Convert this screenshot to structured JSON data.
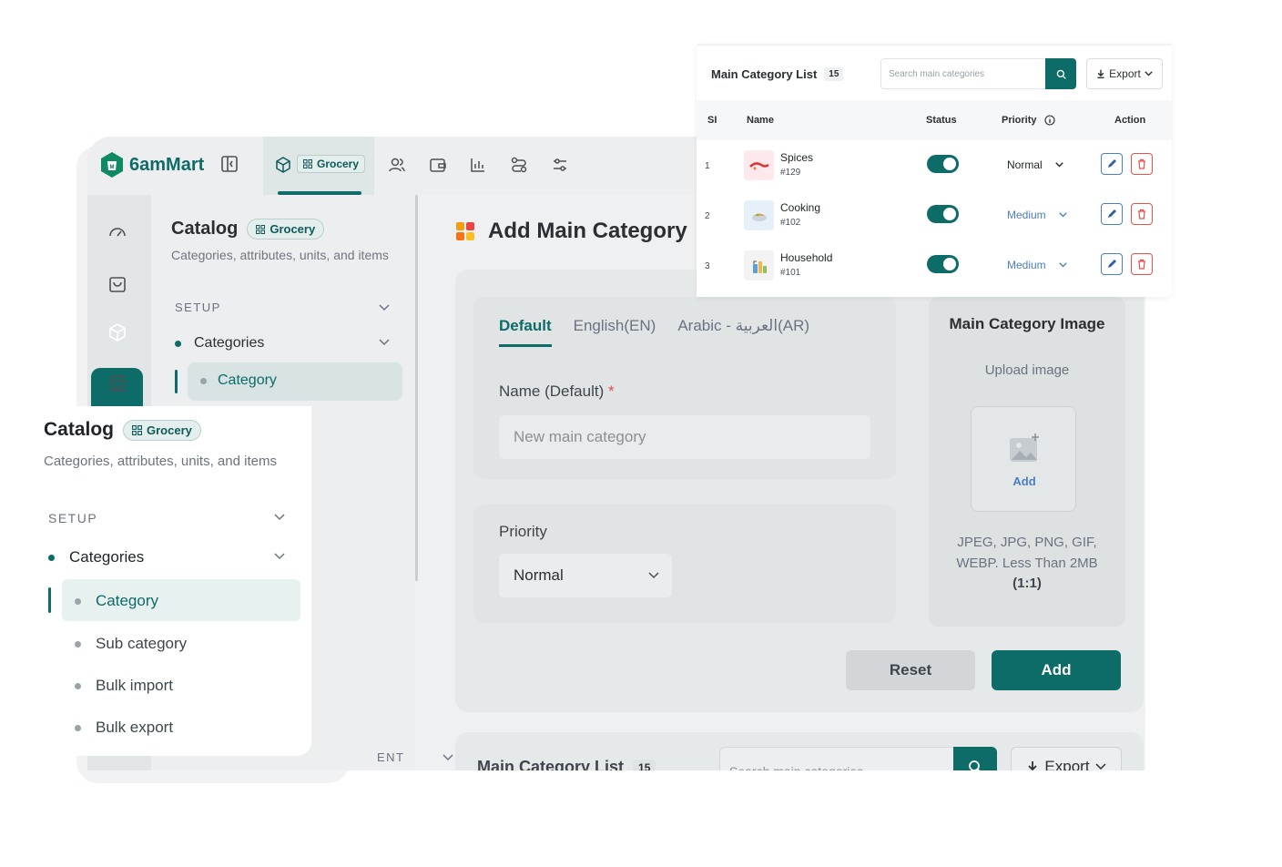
{
  "colors": {
    "brand": "#0d6b68",
    "danger": "#e5534b",
    "link": "#4a7fc1"
  },
  "app": {
    "logo_text": "6amMart",
    "module_chip": "Grocery"
  },
  "sidebar": {
    "title": "Catalog",
    "chip": "Grocery",
    "subtitle": "Categories, attributes, units, and items",
    "section": "SETUP",
    "group": "Categories",
    "active_item": "Category",
    "partial_section": "ENT"
  },
  "page": {
    "title": "Add Main Category",
    "tabs": [
      "Default",
      "English(EN)",
      "Arabic - العربية(AR)"
    ],
    "name_label": "Name (Default)",
    "required_mark": "*",
    "name_placeholder": "New main category",
    "priority_label": "Priority",
    "priority_value": "Normal",
    "image": {
      "title": "Main Category Image",
      "subtitle": "Upload image",
      "add_label": "Add",
      "hint": "JPEG, JPG, PNG, GIF, WEBP. Less Than 2MB",
      "ratio": "(1:1)"
    },
    "reset_label": "Reset",
    "add_label": "Add"
  },
  "list_bg": {
    "title": "Main Category List",
    "count": "15",
    "search_placeholder": "Search main categories",
    "export_label": "Export"
  },
  "fg_sidebar": {
    "title": "Catalog",
    "chip": "Grocery",
    "subtitle": "Categories, attributes, units, and items",
    "section": "SETUP",
    "group": "Categories",
    "items": [
      "Category",
      "Sub category",
      "Bulk import",
      "Bulk export"
    ]
  },
  "table": {
    "title": "Main Category List",
    "count": "15",
    "search_placeholder": "Search main categories",
    "export_label": "Export",
    "columns": [
      "SI",
      "Name",
      "Status",
      "Priority",
      "Action"
    ],
    "rows": [
      {
        "si": "1",
        "name": "Spices",
        "id": "#129",
        "status": true,
        "priority": "Normal"
      },
      {
        "si": "2",
        "name": "Cooking",
        "id": "#102",
        "status": true,
        "priority": "Medium"
      },
      {
        "si": "3",
        "name": "Household",
        "id": "#101",
        "status": true,
        "priority": "Medium"
      }
    ]
  }
}
